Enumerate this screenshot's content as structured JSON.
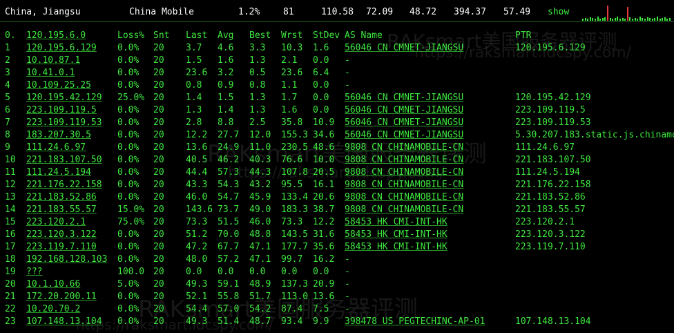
{
  "header": {
    "location": "China, Jiangsu",
    "isp": "China Mobile",
    "loss": "1.2%",
    "sent": "81",
    "last": "110.58",
    "avg": "72.09",
    "best": "48.72",
    "worst": "394.37",
    "stdev": "57.49",
    "show": "show"
  },
  "sparkline": [
    3,
    4,
    3,
    5,
    4,
    3,
    6,
    3,
    4,
    5,
    22,
    4,
    3,
    4,
    6,
    3,
    4,
    3,
    20,
    5,
    3,
    4,
    3,
    6,
    4,
    3,
    5,
    4,
    3,
    4,
    6,
    3,
    4,
    5,
    3,
    4
  ],
  "columns": {
    "hop": "0.",
    "host": "120.195.6.0",
    "loss": "Loss%",
    "snt": "Snt",
    "last": "Last",
    "avg": "Avg",
    "best": "Best",
    "wrst": "Wrst",
    "stdev": "StDev",
    "as": "AS Name",
    "ptr": "PTR"
  },
  "rows": [
    {
      "hop": "1",
      "host": "120.195.6.129",
      "loss": "0.0%",
      "snt": "20",
      "last": "3.7",
      "avg": "4.6",
      "best": "3.3",
      "wrst": "10.3",
      "stdev": "1.6",
      "as": "56046 CN CMNET-JIANGSU",
      "ptr": "120.195.6.129"
    },
    {
      "hop": "2",
      "host": "10.10.87.1",
      "loss": "0.0%",
      "snt": "20",
      "last": "1.5",
      "avg": "1.6",
      "best": "1.3",
      "wrst": "2.1",
      "stdev": "0.0",
      "as": "-",
      "ptr": ""
    },
    {
      "hop": "3",
      "host": "10.41.0.1",
      "loss": "0.0%",
      "snt": "20",
      "last": "23.6",
      "avg": "3.2",
      "best": "0.5",
      "wrst": "23.6",
      "stdev": "6.4",
      "as": "-",
      "ptr": ""
    },
    {
      "hop": "4",
      "host": "10.109.25.25",
      "loss": "0.0%",
      "snt": "20",
      "last": "0.8",
      "avg": "0.9",
      "best": "0.8",
      "wrst": "1.1",
      "stdev": "0.0",
      "as": "-",
      "ptr": ""
    },
    {
      "hop": "5",
      "host": "120.195.42.129",
      "loss": "25.0%",
      "snt": "20",
      "last": "1.4",
      "avg": "1.5",
      "best": "1.3",
      "wrst": "1.7",
      "stdev": "0.0",
      "as": "56046 CN CMNET-JIANGSU",
      "ptr": "120.195.42.129"
    },
    {
      "hop": "6",
      "host": "223.109.119.5",
      "loss": "0.0%",
      "snt": "20",
      "last": "1.3",
      "avg": "1.4",
      "best": "1.3",
      "wrst": "1.6",
      "stdev": "0.0",
      "as": "56046 CN CMNET-JIANGSU",
      "ptr": "223.109.119.5"
    },
    {
      "hop": "7",
      "host": "223.109.119.53",
      "loss": "0.0%",
      "snt": "20",
      "last": "2.8",
      "avg": "8.8",
      "best": "2.5",
      "wrst": "35.8",
      "stdev": "10.9",
      "as": "56046 CN CMNET-JIANGSU",
      "ptr": "223.109.119.53"
    },
    {
      "hop": "8",
      "host": "183.207.30.5",
      "loss": "0.0%",
      "snt": "20",
      "last": "12.2",
      "avg": "27.7",
      "best": "12.0",
      "wrst": "155.3",
      "stdev": "34.6",
      "as": "56046 CN CMNET-JIANGSU",
      "ptr": "5.30.207.183.static.js.chinamo"
    },
    {
      "hop": "9",
      "host": "111.24.6.97",
      "loss": "0.0%",
      "snt": "20",
      "last": "13.6",
      "avg": "24.9",
      "best": "11.0",
      "wrst": "230.5",
      "stdev": "48.6",
      "as": "9808  CN CHINAMOBILE-CN",
      "ptr": "111.24.6.97"
    },
    {
      "hop": "10",
      "host": "221.183.107.50",
      "loss": "0.0%",
      "snt": "20",
      "last": "40.5",
      "avg": "46.2",
      "best": "40.3",
      "wrst": "76.6",
      "stdev": "10.0",
      "as": "9808  CN CHINAMOBILE-CN",
      "ptr": "221.183.107.50"
    },
    {
      "hop": "11",
      "host": "111.24.5.194",
      "loss": "0.0%",
      "snt": "20",
      "last": "44.4",
      "avg": "57.3",
      "best": "44.3",
      "wrst": "107.8",
      "stdev": "20.5",
      "as": "9808  CN CHINAMOBILE-CN",
      "ptr": "111.24.5.194"
    },
    {
      "hop": "12",
      "host": "221.176.22.158",
      "loss": "0.0%",
      "snt": "20",
      "last": "43.3",
      "avg": "54.3",
      "best": "43.2",
      "wrst": "95.5",
      "stdev": "16.1",
      "as": "9808  CN CHINAMOBILE-CN",
      "ptr": "221.176.22.158"
    },
    {
      "hop": "13",
      "host": "221.183.52.86",
      "loss": "0.0%",
      "snt": "20",
      "last": "46.0",
      "avg": "54.7",
      "best": "45.9",
      "wrst": "133.4",
      "stdev": "20.6",
      "as": "9808  CN CHINAMOBILE-CN",
      "ptr": "221.183.52.86"
    },
    {
      "hop": "14",
      "host": "221.183.55.57",
      "loss": "15.0%",
      "snt": "20",
      "last": "143.6",
      "avg": "73.7",
      "best": "49.0",
      "wrst": "183.3",
      "stdev": "38.7",
      "as": "9808  CN CHINAMOBILE-CN",
      "ptr": "221.183.55.57"
    },
    {
      "hop": "15",
      "host": "223.120.2.1",
      "loss": "75.0%",
      "snt": "20",
      "last": "73.3",
      "avg": "51.5",
      "best": "46.0",
      "wrst": "73.3",
      "stdev": "12.2",
      "as": "58453 HK CMI-INT-HK",
      "ptr": "223.120.2.1"
    },
    {
      "hop": "16",
      "host": "223.120.3.122",
      "loss": "0.0%",
      "snt": "20",
      "last": "51.2",
      "avg": "70.0",
      "best": "48.8",
      "wrst": "143.5",
      "stdev": "31.6",
      "as": "58453 HK CMI-INT-HK",
      "ptr": "223.120.3.122"
    },
    {
      "hop": "17",
      "host": "223.119.7.110",
      "loss": "0.0%",
      "snt": "20",
      "last": "47.2",
      "avg": "67.7",
      "best": "47.1",
      "wrst": "177.7",
      "stdev": "35.6",
      "as": "58453 HK CMI-INT-HK",
      "ptr": "223.119.7.110"
    },
    {
      "hop": "18",
      "host": "192.168.128.103",
      "loss": "0.0%",
      "snt": "20",
      "last": "48.0",
      "avg": "57.2",
      "best": "47.1",
      "wrst": "99.7",
      "stdev": "16.2",
      "as": "-",
      "ptr": ""
    },
    {
      "hop": "19",
      "host": "???",
      "loss": "100.0",
      "snt": "20",
      "last": "0.0",
      "avg": "0.0",
      "best": "0.0",
      "wrst": "0.0",
      "stdev": "0.0",
      "as": "-",
      "ptr": ""
    },
    {
      "hop": "20",
      "host": "10.1.10.66",
      "loss": "5.0%",
      "snt": "20",
      "last": "49.3",
      "avg": "59.1",
      "best": "48.9",
      "wrst": "137.3",
      "stdev": "20.9",
      "as": "-",
      "ptr": ""
    },
    {
      "hop": "21",
      "host": "172.20.200.11",
      "loss": "0.0%",
      "snt": "20",
      "last": "52.1",
      "avg": "55.8",
      "best": "51.7",
      "wrst": "113.0",
      "stdev": "13.6",
      "as": "-",
      "ptr": ""
    },
    {
      "hop": "22",
      "host": "10.20.70.2",
      "loss": "0.0%",
      "snt": "20",
      "last": "54.4",
      "avg": "57.0",
      "best": "54.2",
      "wrst": "87.4",
      "stdev": "7.5",
      "as": "-",
      "ptr": ""
    },
    {
      "hop": "23",
      "host": "107.148.13.104",
      "loss": "0.0%",
      "snt": "20",
      "last": "49.3",
      "avg": "51.4",
      "best": "48.7",
      "wrst": "93.4",
      "stdev": "9.9",
      "as": "398478 US PEGTECHINC-AP-01",
      "ptr": "107.148.13.104"
    }
  ],
  "watermarks": [
    "RAKsmart美国服务器评测",
    "https://raksmart.idcspy.com/"
  ]
}
